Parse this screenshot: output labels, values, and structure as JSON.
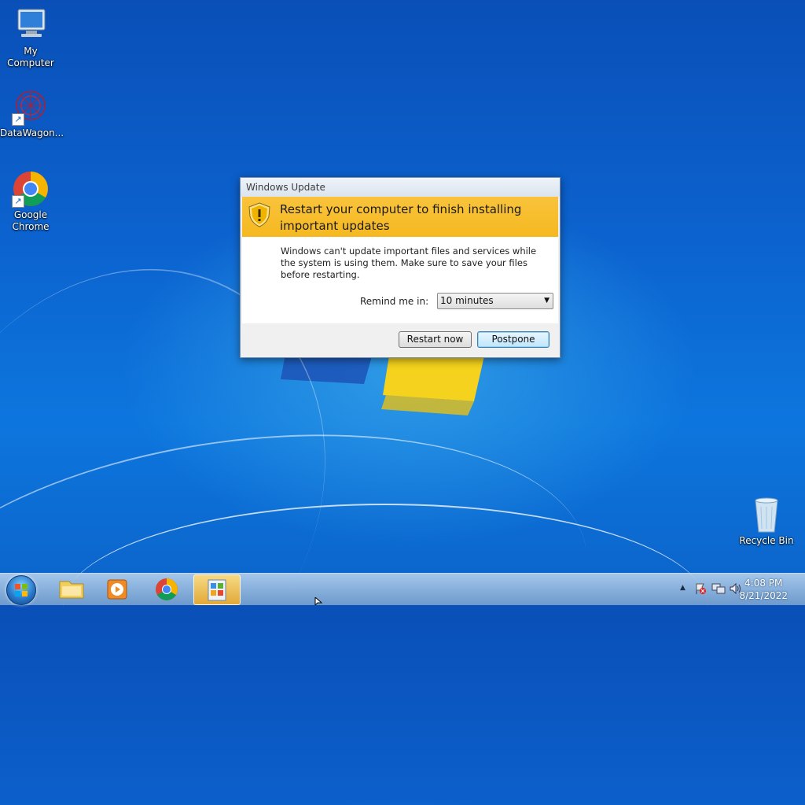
{
  "desktop": {
    "icons": [
      {
        "label": "My Computer"
      },
      {
        "label": "DataWagon..."
      },
      {
        "label": "Google Chrome"
      },
      {
        "label": "Recycle Bin"
      }
    ]
  },
  "dialog": {
    "title": "Windows Update",
    "heading": "Restart your computer to finish installing important updates",
    "message": "Windows can't update important files and services while the system is using them. Make sure to save your files before restarting.",
    "remind_label": "Remind me in:",
    "remind_value": "10 minutes",
    "restart_label": "Restart now",
    "postpone_label": "Postpone"
  },
  "taskbar": {
    "pinned": [
      "start-button",
      "explorer-icon",
      "media-player-icon",
      "chrome-icon",
      "windows-update-icon"
    ],
    "clock": {
      "time": "4:08 PM",
      "date": "8/21/2022"
    }
  },
  "colors": {
    "banner": "#f5b820",
    "desktop_blue": "#0d76de"
  }
}
